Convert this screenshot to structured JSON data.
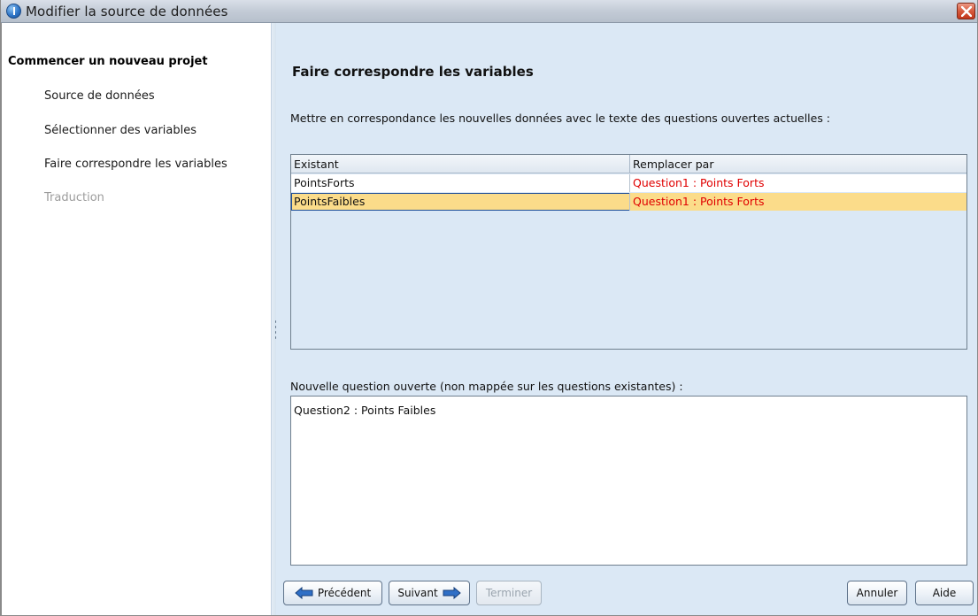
{
  "window": {
    "title": "Modifier la source de données"
  },
  "steps": {
    "heading": "Commencer un nouveau projet",
    "items": [
      {
        "label": "Source de données",
        "enabled": true
      },
      {
        "label": "Sélectionner des variables",
        "enabled": true
      },
      {
        "label": "Faire correspondre les variables",
        "enabled": true
      },
      {
        "label": "Traduction",
        "enabled": false
      }
    ]
  },
  "main": {
    "title": "Faire correspondre les variables",
    "instruction": "Mettre en correspondance les nouvelles données avec le texte des questions ouvertes actuelles :",
    "table": {
      "columns": [
        "Existant",
        "Remplacer par"
      ],
      "rows": [
        {
          "existing": "PointsForts",
          "replace": "Question1 : Points Forts",
          "selected": false
        },
        {
          "existing": "PointsFaibles",
          "replace": "Question1 : Points Forts",
          "selected": true
        }
      ]
    },
    "new_questions_label": "Nouvelle question ouverte (non mappée sur les questions existantes) :",
    "new_questions": [
      "Question2 : Points Faibles"
    ]
  },
  "buttons": {
    "previous": "Précédent",
    "next": "Suivant",
    "finish": "Terminer",
    "cancel": "Annuler",
    "help": "Aide"
  },
  "colors": {
    "panel_bg": "#dbe8f5",
    "selected_row": "#fbdc8a",
    "replace_text": "#e00000",
    "arrow_fill": "#2f6fc6"
  }
}
